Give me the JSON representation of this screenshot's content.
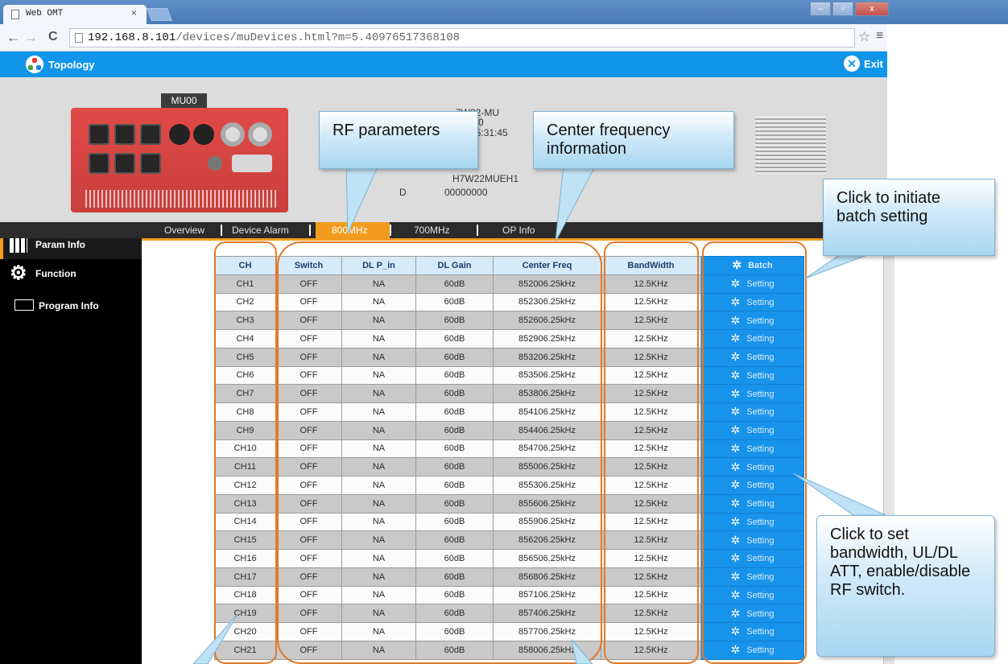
{
  "browser": {
    "tab_title": "Web OMT",
    "tab_close": "×",
    "url_host": "192.168.8.101",
    "url_path": "/devices/muDevices.html?m=5.40976517368108",
    "back": "←",
    "forward": "→",
    "reload": "C",
    "bookmark_icon": "☆",
    "menu_icon": "≡"
  },
  "header": {
    "topology_label": "Topology",
    "exit_label": "Exit",
    "color": "#1195e8"
  },
  "device": {
    "tag": "MU00",
    "model_fragment": "7W22-MU",
    "id_fragment": "0/0/0",
    "time_fragment": "7 15:31:45",
    "serial_fragment": "H7W22MUEH1",
    "id_value": "00000000",
    "d_fragment": "D"
  },
  "tabs": {
    "overview": "Overview",
    "device_alarm": "Device Alarm",
    "band_800": "800MHz",
    "band_700": "700MHz",
    "op_info": "OP Info"
  },
  "sidebar": {
    "items": [
      {
        "label": "Param Info",
        "icon": "grid-icon"
      },
      {
        "label": "Function",
        "icon": "gear-icon"
      },
      {
        "label": "Program Info",
        "icon": "monitor-icon"
      }
    ]
  },
  "table": {
    "headers": [
      "CH",
      "Switch",
      "DL P_in",
      "DL Gain",
      "Center Freq",
      "BandWidth",
      "Batch"
    ],
    "action_label": "Setting",
    "rows": [
      [
        "CH1",
        "OFF",
        "NA",
        "60dB",
        "852006.25kHz",
        "12.5KHz"
      ],
      [
        "CH2",
        "OFF",
        "NA",
        "60dB",
        "852306.25kHz",
        "12.5KHz"
      ],
      [
        "CH3",
        "OFF",
        "NA",
        "60dB",
        "852606.25kHz",
        "12.5KHz"
      ],
      [
        "CH4",
        "OFF",
        "NA",
        "60dB",
        "852906.25kHz",
        "12.5KHz"
      ],
      [
        "CH5",
        "OFF",
        "NA",
        "60dB",
        "853206.25kHz",
        "12.5KHz"
      ],
      [
        "CH6",
        "OFF",
        "NA",
        "60dB",
        "853506.25kHz",
        "12.5KHz"
      ],
      [
        "CH7",
        "OFF",
        "NA",
        "60dB",
        "853806.25kHz",
        "12.5KHz"
      ],
      [
        "CH8",
        "OFF",
        "NA",
        "60dB",
        "854106.25kHz",
        "12.5KHz"
      ],
      [
        "CH9",
        "OFF",
        "NA",
        "60dB",
        "854406.25kHz",
        "12.5KHz"
      ],
      [
        "CH10",
        "OFF",
        "NA",
        "60dB",
        "854706.25kHz",
        "12.5KHz"
      ],
      [
        "CH11",
        "OFF",
        "NA",
        "60dB",
        "855006.25kHz",
        "12.5KHz"
      ],
      [
        "CH12",
        "OFF",
        "NA",
        "60dB",
        "855306.25kHz",
        "12.5KHz"
      ],
      [
        "CH13",
        "OFF",
        "NA",
        "60dB",
        "855606.25kHz",
        "12.5KHz"
      ],
      [
        "CH14",
        "OFF",
        "NA",
        "60dB",
        "855906.25kHz",
        "12.5KHz"
      ],
      [
        "CH15",
        "OFF",
        "NA",
        "60dB",
        "856206.25kHz",
        "12.5KHz"
      ],
      [
        "CH16",
        "OFF",
        "NA",
        "60dB",
        "856506.25kHz",
        "12.5KHz"
      ],
      [
        "CH17",
        "OFF",
        "NA",
        "60dB",
        "856806.25kHz",
        "12.5KHz"
      ],
      [
        "CH18",
        "OFF",
        "NA",
        "60dB",
        "857106.25kHz",
        "12.5KHz"
      ],
      [
        "CH19",
        "OFF",
        "NA",
        "60dB",
        "857406.25kHz",
        "12.5KHz"
      ],
      [
        "CH20",
        "OFF",
        "NA",
        "60dB",
        "857706.25kHz",
        "12.5KHz"
      ],
      [
        "CH21",
        "OFF",
        "NA",
        "60dB",
        "858006.25kHz",
        "12.5KHz"
      ]
    ]
  },
  "callouts": {
    "rf": "RF parameters",
    "center": "Center frequency information",
    "batch": "Click to initiate batch setting",
    "setting": "Click to set bandwidth, UL/DL ATT, enable/disable RF switch."
  }
}
